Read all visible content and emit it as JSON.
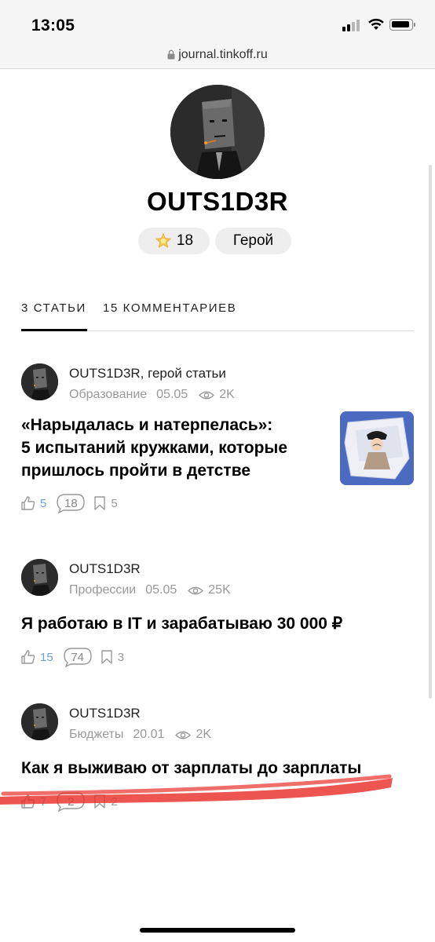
{
  "status_bar": {
    "time": "13:05"
  },
  "browser": {
    "url": "journal.tinkoff.ru"
  },
  "profile": {
    "username": "OUTS1D3R",
    "rating": "18",
    "role": "Герой"
  },
  "tabs": [
    {
      "label": "3 СТАТЬИ",
      "active": true
    },
    {
      "label": "15 КОММЕНТАРИЕВ",
      "active": false
    }
  ],
  "articles": [
    {
      "author": "OUTS1D3R, герой статьи",
      "category": "Образование",
      "date": "05.05",
      "views": "2K",
      "title_line1": "«Нарыдалась и натерпелась»:",
      "title_line2": "5 испытаний кружками, которые",
      "title_line3": "пришлось пройти в детстве",
      "likes": "5",
      "comments": "18",
      "bookmarks": "5"
    },
    {
      "author": "OUTS1D3R",
      "category": "Профессии",
      "date": "05.05",
      "views": "25K",
      "title_line1": "Я работаю в IT и зарабатываю 30 000 ₽",
      "likes": "15",
      "comments": "74",
      "bookmarks": "3"
    },
    {
      "author": "OUTS1D3R",
      "category": "Бюджеты",
      "date": "20.01",
      "views": "2K",
      "title_line1": "Как я выживаю от зарплаты до зарплаты",
      "likes": "7",
      "comments": "2",
      "bookmarks": "2"
    }
  ],
  "colors": {
    "like_blue": "#6e9fd2",
    "muted_gray": "#999999",
    "pill_bg": "#eeeeee",
    "red_mark": "#e8302a"
  }
}
